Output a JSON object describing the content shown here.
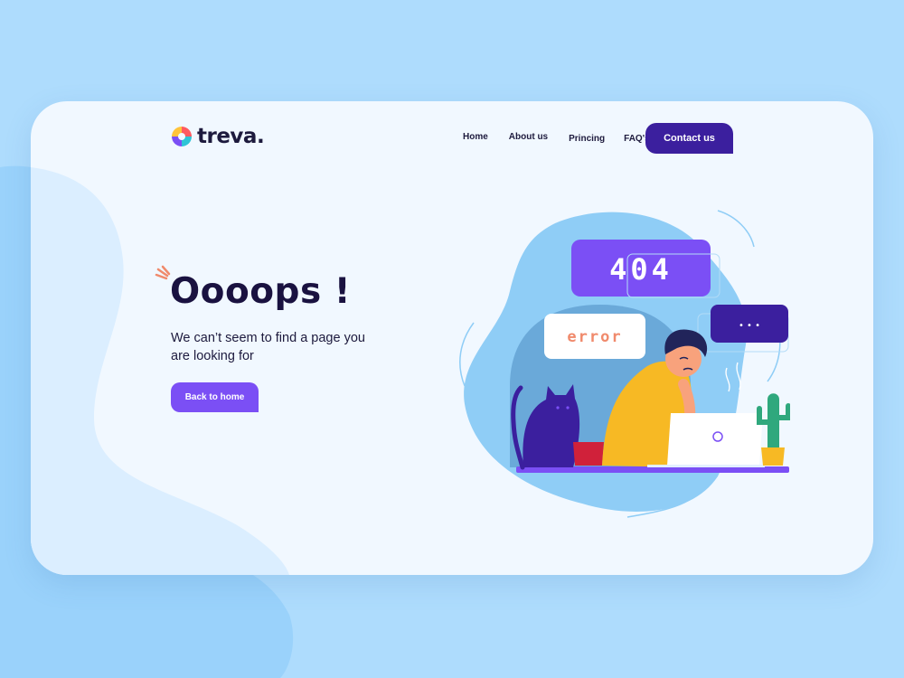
{
  "brand": {
    "name": "treva."
  },
  "nav": {
    "items": [
      {
        "label": "Home"
      },
      {
        "label": "About us"
      },
      {
        "label": "Princing"
      },
      {
        "label": "FAQ's"
      }
    ],
    "contact_label": "Contact us"
  },
  "hero": {
    "headline": "Oooops !",
    "subtext": "We can’t seem to find a page you are looking for",
    "back_label": "Back to home"
  },
  "illustration": {
    "code_label": "404",
    "error_label": "error",
    "dots_label": "• • •"
  },
  "colors": {
    "accent_dark": "#3b1f9e",
    "accent": "#7b4ff5",
    "text": "#1d1a3d",
    "error_text": "#f08a6c"
  }
}
